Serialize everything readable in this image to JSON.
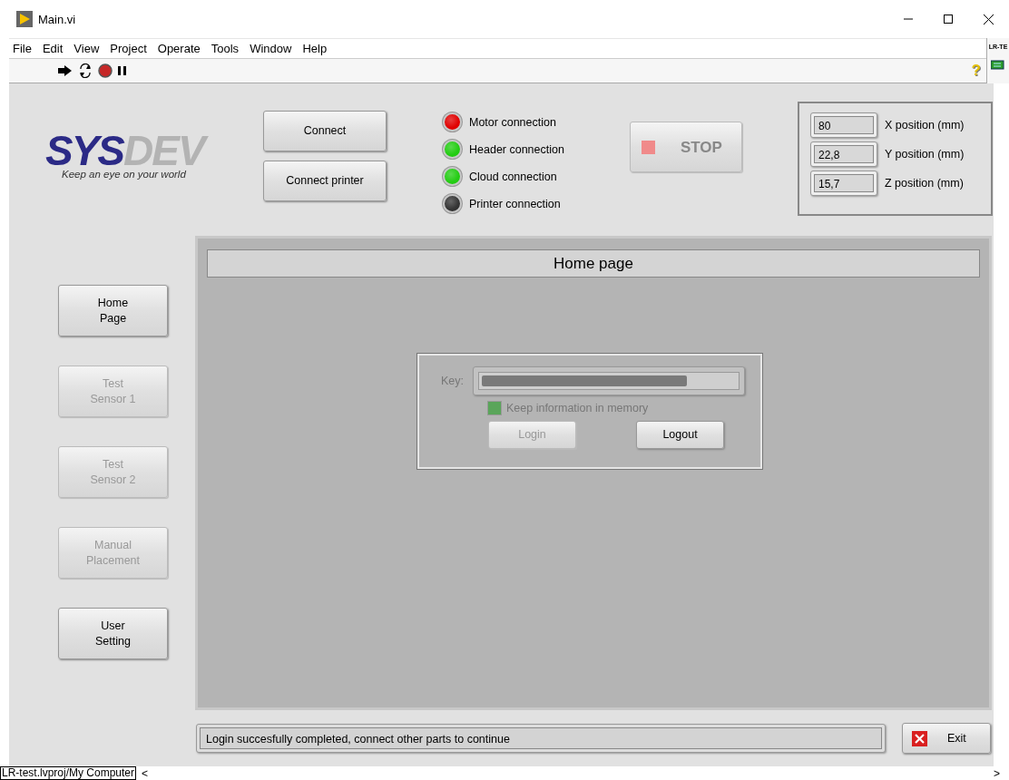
{
  "window": {
    "title": "Main.vi"
  },
  "menu": [
    "File",
    "Edit",
    "View",
    "Project",
    "Operate",
    "Tools",
    "Window",
    "Help"
  ],
  "toolbar": {
    "help": "?",
    "connector": "LR-TE"
  },
  "logo": {
    "brand_a": "SYS",
    "brand_b": "DEV",
    "tagline": "Keep an eye on your world"
  },
  "connect_buttons": [
    {
      "label": "Connect"
    },
    {
      "label": "Connect printer"
    }
  ],
  "indicators": [
    {
      "label": "Motor connection",
      "color": "#e00000"
    },
    {
      "label": "Header connection",
      "color": "#22cc11"
    },
    {
      "label": "Cloud connection",
      "color": "#22cc11"
    },
    {
      "label": "Printer connection",
      "color": "#333333"
    }
  ],
  "stop_button": {
    "label": "STOP",
    "disabled": true
  },
  "positions": [
    {
      "value": "80",
      "label": "X position (mm)"
    },
    {
      "value": "22,8",
      "label": "Y position (mm)"
    },
    {
      "value": "15,7",
      "label": "Z position (mm)"
    }
  ],
  "nav": [
    {
      "label": "Home\nPage",
      "disabled": false
    },
    {
      "label": "Test\nSensor 1",
      "disabled": true
    },
    {
      "label": "Test\nSensor 2",
      "disabled": true
    },
    {
      "label": "Manual\nPlacement",
      "disabled": true
    },
    {
      "label": "User\nSetting",
      "disabled": false
    }
  ],
  "page": {
    "title": "Home page"
  },
  "login": {
    "key_label": "Key:",
    "disabled": true,
    "checkbox": {
      "label": "Keep information in memory",
      "checked": true
    },
    "buttons": [
      {
        "label": "Login",
        "disabled": true
      },
      {
        "label": "Logout",
        "disabled": false
      }
    ]
  },
  "status_message": "Login succesfully completed, connect other parts to continue",
  "exit_button": {
    "label": "Exit"
  },
  "status_bar": {
    "path": "LR-test.lvproj/My Computer",
    "left": "<",
    "right": ">"
  }
}
